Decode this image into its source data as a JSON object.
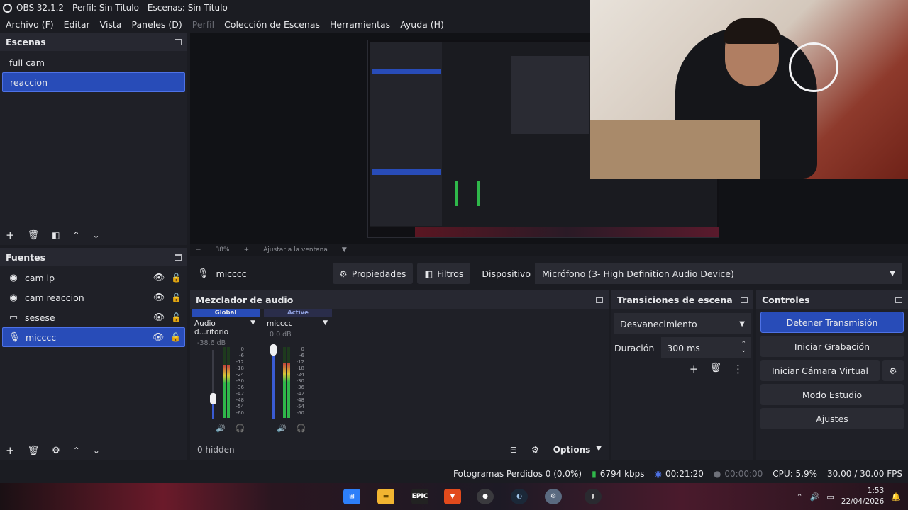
{
  "window": {
    "title": "OBS 32.1.2 - Perfil: Sin Título - Escenas: Sin Título"
  },
  "menu": {
    "items": [
      "Archivo (F)",
      "Editar",
      "Vista",
      "Paneles (D)",
      "Perfil",
      "Colección de Escenas",
      "Herramientas",
      "Ayuda (H)"
    ]
  },
  "scenes": {
    "title": "Escenas",
    "items": [
      "full cam",
      "reaccion"
    ],
    "selected": "reaccion"
  },
  "sources": {
    "title": "Fuentes",
    "items": [
      {
        "name": "cam ip",
        "icon": "camera-icon"
      },
      {
        "name": "cam reaccion",
        "icon": "camera-icon"
      },
      {
        "name": "sesese",
        "icon": "monitor-icon"
      },
      {
        "name": "micccc",
        "icon": "microphone-icon"
      }
    ],
    "selected": "micccc"
  },
  "preview": {
    "zoom": "38%",
    "fit": "Ajustar a la ventana"
  },
  "context": {
    "source": "micccc",
    "properties": "Propiedades",
    "filters": "Filtros",
    "device_label": "Dispositivo",
    "device_value": "Micrófono (3- High Definition Audio Device)"
  },
  "mixer": {
    "title": "Mezclador de audio",
    "channels": [
      {
        "tab": "Global",
        "name": "Audio d...ritorio",
        "db": "-38.6 dB",
        "volume": 0.3,
        "level": 0.75
      },
      {
        "tab": "Active",
        "name": "micccc",
        "db": "0.0 dB",
        "volume": 1.0,
        "level": 0.78
      }
    ],
    "scale": [
      "0",
      "-6",
      "-12",
      "-18",
      "-24",
      "-30",
      "-36",
      "-42",
      "-48",
      "-54",
      "-60"
    ],
    "hidden": "0 hidden",
    "options": "Options"
  },
  "transitions": {
    "title": "Transiciones de escena",
    "selected": "Desvanecimiento",
    "duration_label": "Duración",
    "duration_value": "300 ms"
  },
  "controls": {
    "title": "Controles",
    "buttons": [
      "Detener Transmisión",
      "Iniciar Grabación",
      "Iniciar Cámara Virtual",
      "Modo Estudio",
      "Ajustes"
    ]
  },
  "status": {
    "dropped": "Fotogramas Perdidos 0 (0.0%)",
    "bitrate": "6794 kbps",
    "stream_time": "00:21:20",
    "rec_time": "00:00:00",
    "cpu": "CPU: 5.9%",
    "fps": "30.00 / 30.00 FPS"
  },
  "taskbar": {
    "time": "1:53",
    "date": "22/04/2026",
    "apps": [
      "windows-start-icon",
      "file-explorer-icon",
      "epic-games-icon",
      "brave-browser-icon",
      "obs-icon",
      "steam-icon",
      "settings-icon",
      "app-icon"
    ],
    "colors": {
      "accent": "#284cb8",
      "meter_green": "#2fb84a",
      "meter_red": "#c23b3b"
    }
  }
}
